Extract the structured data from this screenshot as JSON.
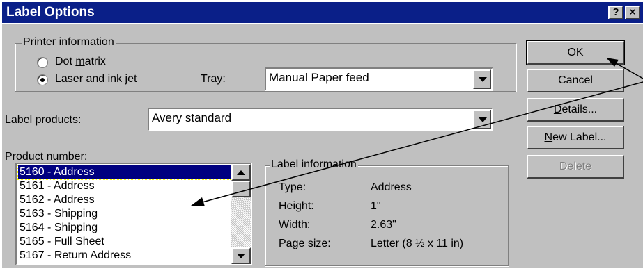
{
  "window": {
    "title": "Label Options"
  },
  "titlebar_buttons": {
    "help": "?",
    "close": "×"
  },
  "printer_info": {
    "legend": "Printer information",
    "options": [
      {
        "label_pre": "Dot ",
        "label_u": "m",
        "label_post": "atrix",
        "selected": false
      },
      {
        "label_pre": "",
        "label_u": "L",
        "label_post": "aser and ink jet",
        "selected": true
      }
    ],
    "tray_label_u": "T",
    "tray_label_post": "ray:",
    "tray_value": "Manual Paper feed"
  },
  "label_products": {
    "label_pre": "Label ",
    "label_u": "p",
    "label_post": "roducts:",
    "value": "Avery standard"
  },
  "product_number": {
    "label_pre": "Product n",
    "label_u": "u",
    "label_post": "mber:",
    "items": [
      "5160 - Address",
      "5161 - Address",
      "5162 - Address",
      "5163 - Shipping",
      "5164 - Shipping",
      "5165 - Full Sheet",
      "5167 - Return Address"
    ],
    "selected_index": 0
  },
  "label_info": {
    "legend": "Label information",
    "rows": [
      {
        "key": "Type:",
        "value": "Address"
      },
      {
        "key": "Height:",
        "value": "1\""
      },
      {
        "key": "Width:",
        "value": "2.63\""
      },
      {
        "key": "Page size:",
        "value": "Letter (8 ½ x 11 in)"
      }
    ]
  },
  "buttons": {
    "ok": "OK",
    "cancel": "Cancel",
    "details_u": "D",
    "details_post": "etails...",
    "new_label_u": "N",
    "new_label_post": "ew Label...",
    "delete": "Delete"
  }
}
